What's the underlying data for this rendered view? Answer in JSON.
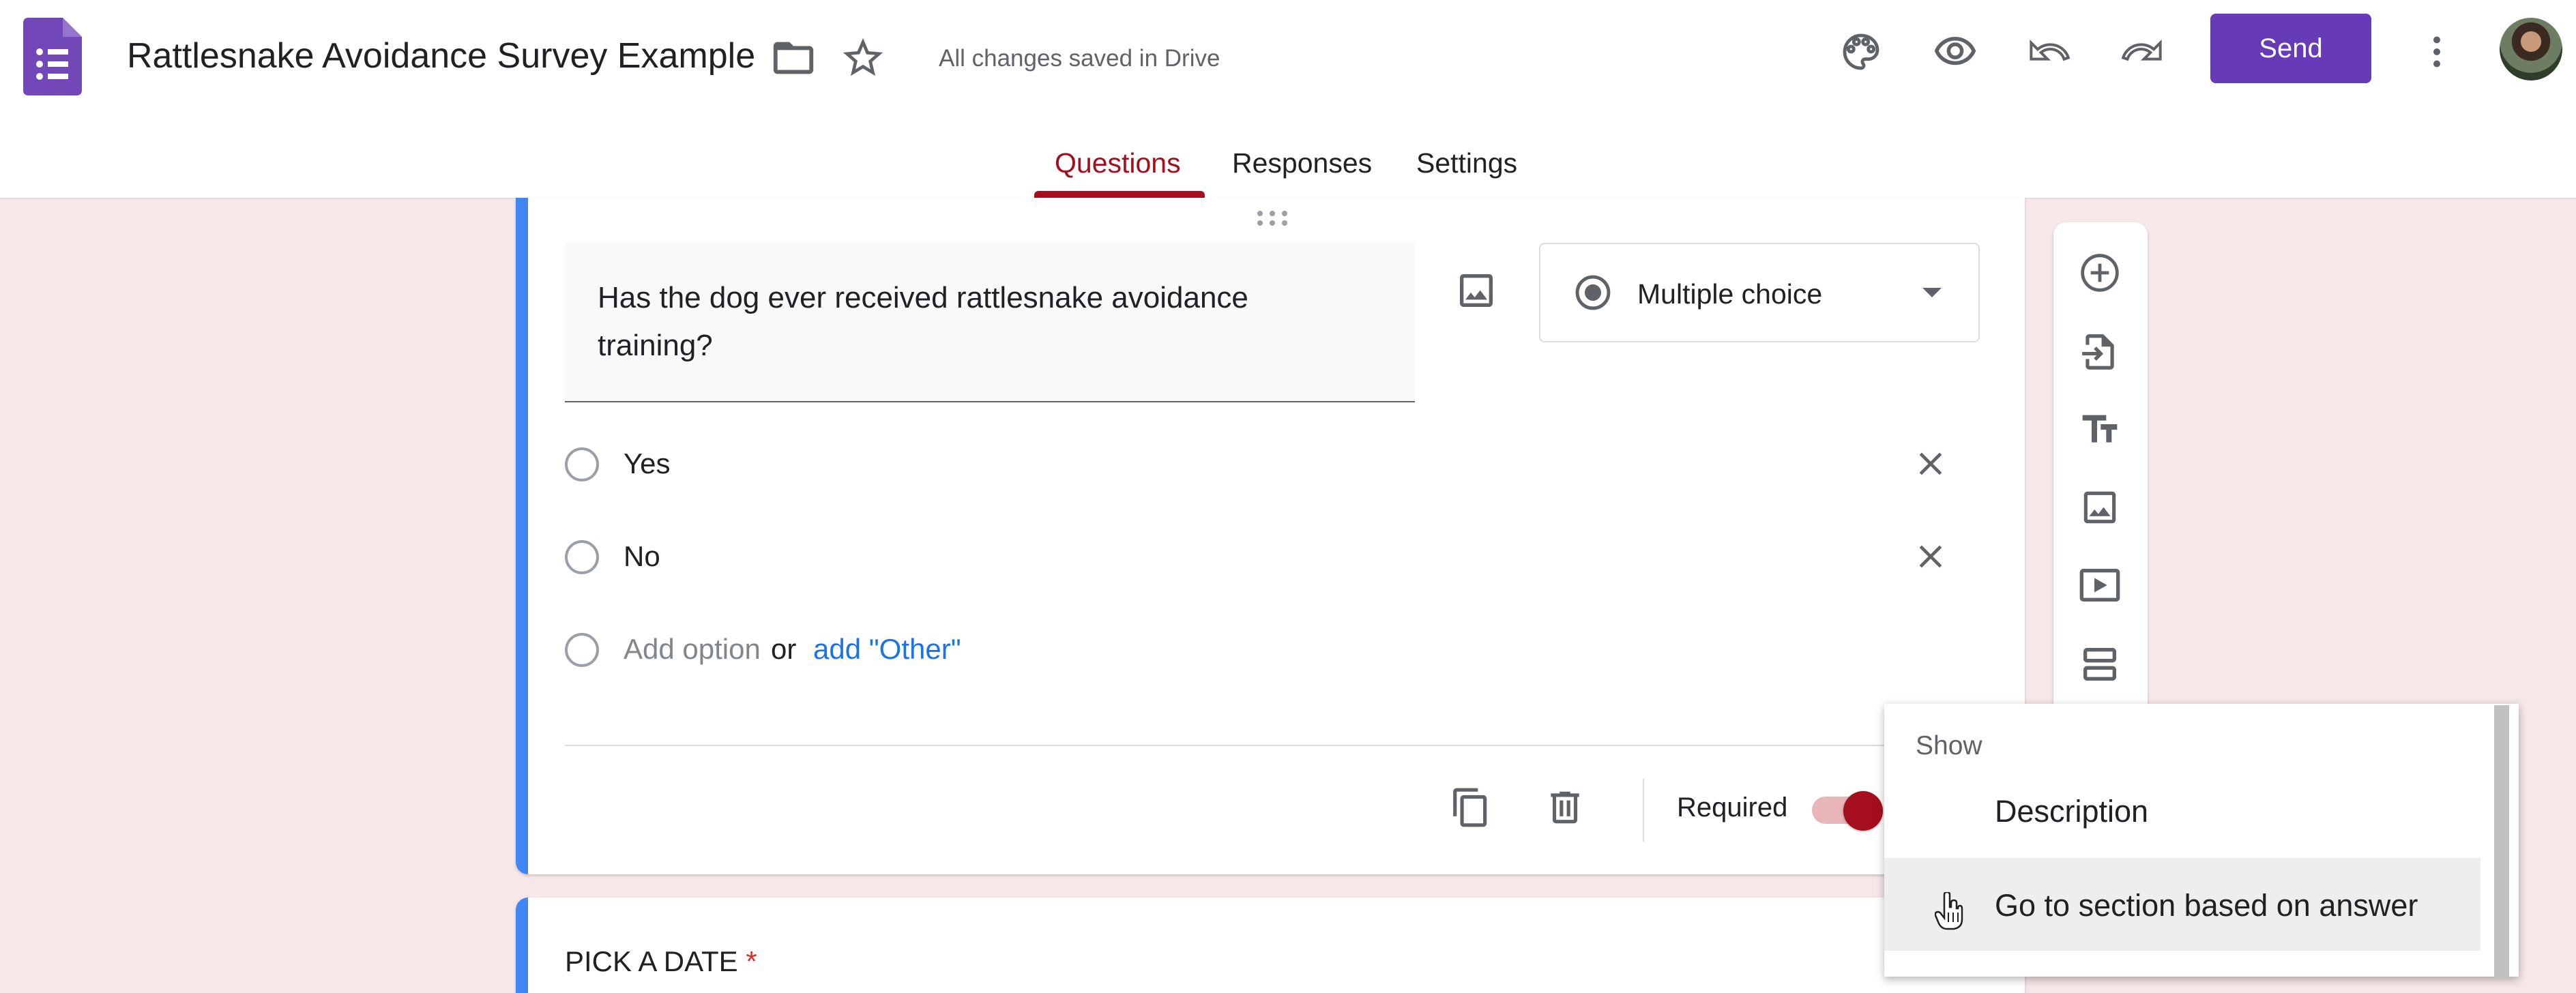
{
  "app": {
    "title": "Rattlesnake Avoidance Survey Example",
    "save_status": "All changes saved in Drive",
    "send_label": "Send",
    "brand_color": "#673ab7",
    "theme_color": "#a50e1e"
  },
  "header_icons": [
    "forms-app-icon",
    "folder-icon",
    "star-icon",
    "palette-icon",
    "preview-eye-icon",
    "undo-icon",
    "redo-icon",
    "more-vert-icon"
  ],
  "tabs": [
    {
      "label": "Questions",
      "active": true
    },
    {
      "label": "Responses",
      "active": false
    },
    {
      "label": "Settings",
      "active": false
    }
  ],
  "question": {
    "text": "Has the dog ever received rattlesnake avoidance training?",
    "type": "Multiple choice",
    "options": [
      {
        "label": "Yes"
      },
      {
        "label": "No"
      }
    ],
    "add_option_label": "Add option",
    "or_label": "or",
    "add_other_label": "add \"Other\"",
    "required_label": "Required",
    "required": true
  },
  "next_question": {
    "title": "PICK A DATE",
    "required_mark": "*"
  },
  "toolbar_icons": [
    "add-question-icon",
    "import-questions-icon",
    "add-title-icon",
    "add-image-icon",
    "add-video-icon",
    "add-section-icon"
  ],
  "menu": {
    "header": "Show",
    "items": [
      {
        "label": "Description",
        "hovered": false
      },
      {
        "label": "Go to section based on answer",
        "hovered": true
      }
    ]
  }
}
